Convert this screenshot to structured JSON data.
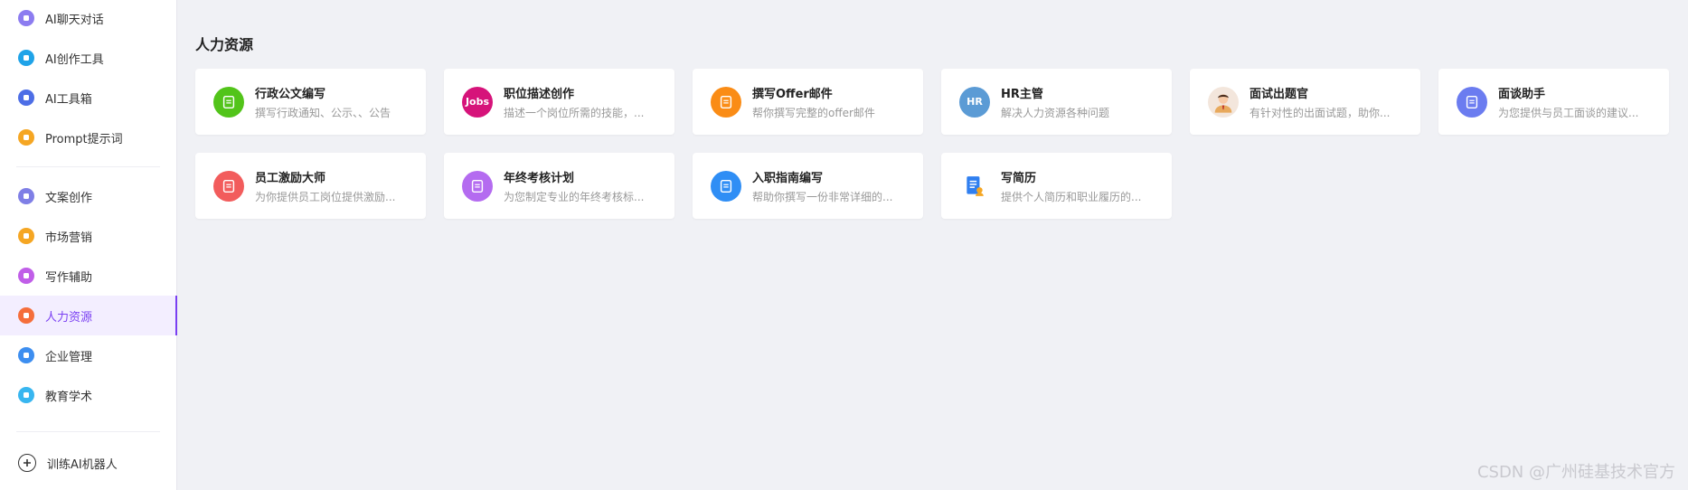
{
  "sidebar": {
    "top_items": [
      {
        "label": "AI聊天对话",
        "icon": "chat-bubble-icon",
        "color": "#8c7cf0"
      },
      {
        "label": "AI创作工具",
        "icon": "pen-icon",
        "color": "#1fa3e8"
      },
      {
        "label": "AI工具箱",
        "icon": "layers-icon",
        "color": "#4d6ee6"
      },
      {
        "label": "Prompt提示词",
        "icon": "prompt-icon",
        "color": "#f5a623"
      }
    ],
    "category_items": [
      {
        "label": "文案创作",
        "icon": "copywriting-icon",
        "color": "#7f7fe6"
      },
      {
        "label": "市场营销",
        "icon": "marketing-icon",
        "color": "#f5a623"
      },
      {
        "label": "写作辅助",
        "icon": "writing-icon",
        "color": "#c05ee8"
      },
      {
        "label": "人力资源",
        "icon": "hr-icon",
        "color": "#f56e3b",
        "active": true
      },
      {
        "label": "企业管理",
        "icon": "enterprise-icon",
        "color": "#3d8ef0"
      },
      {
        "label": "教育学术",
        "icon": "education-icon",
        "color": "#38b6f0"
      }
    ],
    "train_label": "训练AI机器人"
  },
  "main": {
    "section_title": "人力资源",
    "cards": [
      {
        "title": "行政公文编写",
        "desc": "撰写行政通知、公示、、公告",
        "icon": "document-icon",
        "color": "#52c41a"
      },
      {
        "title": "职位描述创作",
        "desc": "描述一个岗位所需的技能，...",
        "icon": "jobs-icon",
        "icon_text": "Jobs",
        "color": "#d6137a"
      },
      {
        "title": "撰写Offer邮件",
        "desc": "帮你撰写完整的offer邮件",
        "icon": "offer-mail-icon",
        "color": "#fa8c16"
      },
      {
        "title": "HR主管",
        "desc": "解决人力资源各种问题",
        "icon": "hr-badge-icon",
        "icon_text": "HR",
        "color": "#5b9bd5"
      },
      {
        "title": "面试出题官",
        "desc": "有针对性的出面试题，助你...",
        "icon": "interviewer-avatar-icon",
        "color": "#f3e6dc"
      },
      {
        "title": "面谈助手",
        "desc": "为您提供与员工面谈的建议...",
        "icon": "interview-note-icon",
        "color": "#6b7cf0"
      },
      {
        "title": "员工激励大师",
        "desc": "为你提供员工岗位提供激励...",
        "icon": "thumbs-up-icon",
        "color": "#f25c5c"
      },
      {
        "title": "年终考核计划",
        "desc": "为您制定专业的年终考核标...",
        "icon": "assessment-icon",
        "color": "#b46bf0"
      },
      {
        "title": "入职指南编写",
        "desc": "帮助你撰写一份非常详细的...",
        "icon": "onboarding-icon",
        "color": "#2f8ef5"
      },
      {
        "title": "写简历",
        "desc": "提供个人简历和职业履历的...",
        "icon": "resume-icon",
        "color": "#ffffff"
      }
    ]
  },
  "watermark": "CSDN @广州硅基技术官方"
}
